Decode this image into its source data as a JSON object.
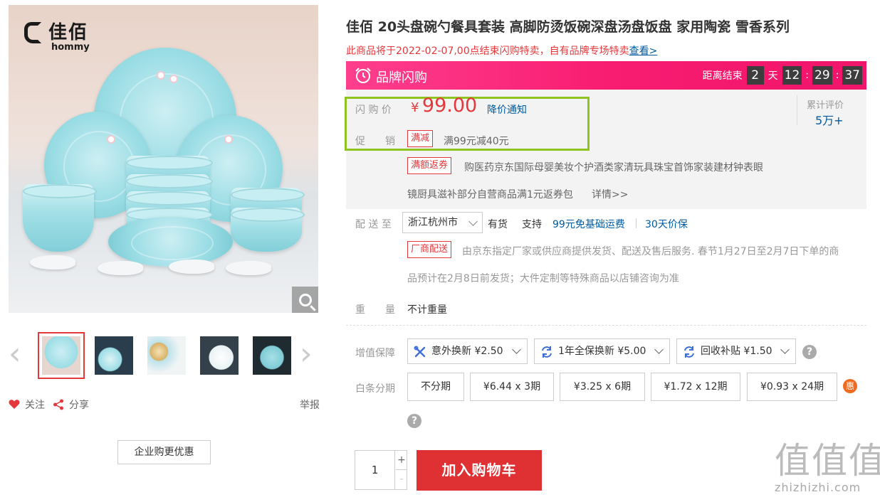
{
  "brand": {
    "cn": "佳佰",
    "en": "hommy"
  },
  "actions": {
    "follow": "关注",
    "share": "分享",
    "report": "举报",
    "enterprise": "企业购更优惠"
  },
  "product": {
    "title": "佳佰 20头盘碗勺餐具套装 高脚防烫饭碗深盘汤盘饭盘 家用陶瓷 雪香系列",
    "notice": "此商品将于2022-02-07,00点结束闪购特卖，自有品牌专场特卖",
    "notice_link": "查看>"
  },
  "flash": {
    "title": "品牌闪购",
    "countdown_label": "距离结束",
    "days": "2",
    "day_unit": "天",
    "hours": "12",
    "minutes": "29",
    "seconds": "37"
  },
  "price": {
    "label": "闪 购 价",
    "currency": "¥",
    "value": "99.00",
    "alert": "降价通知"
  },
  "promo": {
    "label": "促　　销",
    "tag1": "满减",
    "text1": "满99元减40元",
    "tag2": "满额返券",
    "text2": "购医药京东国际母婴美妆个护酒类家清玩具珠宝首饰家装建材钟表眼",
    "text3": "镜厨具滋补部分自营商品满1元返券包",
    "more": "详情>>"
  },
  "review": {
    "label": "累计评价",
    "count": "5万+"
  },
  "delivery": {
    "label": "配 送 至",
    "city": "浙江杭州市",
    "stock": "有货",
    "support": "支持",
    "free_ship": "99元免基础运费",
    "price_protect": "30天价保",
    "tag": "厂商配送",
    "desc1": "由京东指定厂家或供应商提供发货、配送及售后服务. 春节1月27日至2月7日下单的商",
    "desc2": "品预计在2月8日前发货；大件定制等特殊商品以店铺咨询为准"
  },
  "weight": {
    "label": "重　　量",
    "value": "不计重量"
  },
  "services": {
    "label": "增值保障",
    "items": [
      {
        "label": "意外换新 ¥2.50",
        "icon": "tools-icon"
      },
      {
        "label": "1年全保换新 ¥5.00",
        "icon": "exchange-icon"
      },
      {
        "label": "回收补贴 ¥1.50",
        "icon": "recycle-icon"
      }
    ],
    "help": "?"
  },
  "installment": {
    "label": "白条分期",
    "options": [
      "不分期",
      "¥6.44 x 3期",
      "¥3.25 x 6期",
      "¥1.72 x 12期",
      "¥0.93 x 24期"
    ],
    "badge": "惠",
    "help": "?"
  },
  "cart": {
    "qty": "1",
    "plus": "+",
    "minus": "-",
    "add_label": "加入购物车"
  },
  "watermark": {
    "cn": "值值值",
    "en": "zhizhizhi.com"
  },
  "colors": {
    "accent": "#e4393c",
    "flash": "#f81d71",
    "highlight_box": "#8fc31f",
    "link": "#005aa0"
  }
}
